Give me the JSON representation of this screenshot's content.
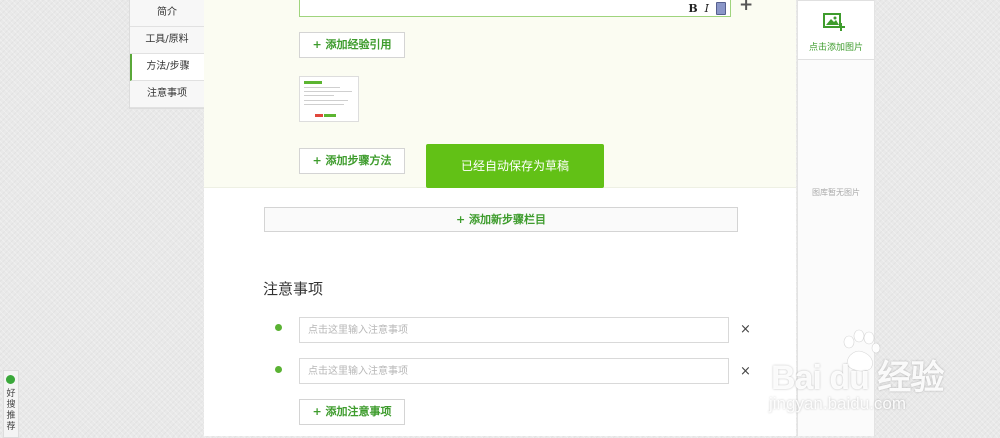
{
  "nav": {
    "items": [
      {
        "label": "简介"
      },
      {
        "label": "工具/原料"
      },
      {
        "label": "方法/步骤"
      },
      {
        "label": "注意事项"
      }
    ],
    "active_index": 2
  },
  "editor": {
    "bold_label": "B",
    "italic_label": "I",
    "add_label": "+"
  },
  "buttons": {
    "add_reference": "+ 添加经验引用",
    "add_step_method": "+ 添加步骤方法",
    "add_new_step_section": "+ 添加新步骤栏目",
    "add_note": "+ 添加注意事项"
  },
  "toast": {
    "message": "已经自动保存为草稿"
  },
  "notes": {
    "title": "注意事项",
    "inputs": [
      {
        "value": "",
        "placeholder": "点击这里输入注意事项"
      },
      {
        "value": "",
        "placeholder": "点击这里输入注意事项"
      }
    ],
    "remove_label": "×"
  },
  "image_panel": {
    "add_label": "点击添加图片",
    "empty_text": "图库暂无图片"
  },
  "side_tab": {
    "label": "好搜推荐"
  },
  "watermark": {
    "brand": "Bai du 经验",
    "url": "jingyan.baidu.com"
  },
  "colors": {
    "accent": "#62c116",
    "link_green": "#3e9c2d",
    "bullet_green": "#5ab233"
  }
}
